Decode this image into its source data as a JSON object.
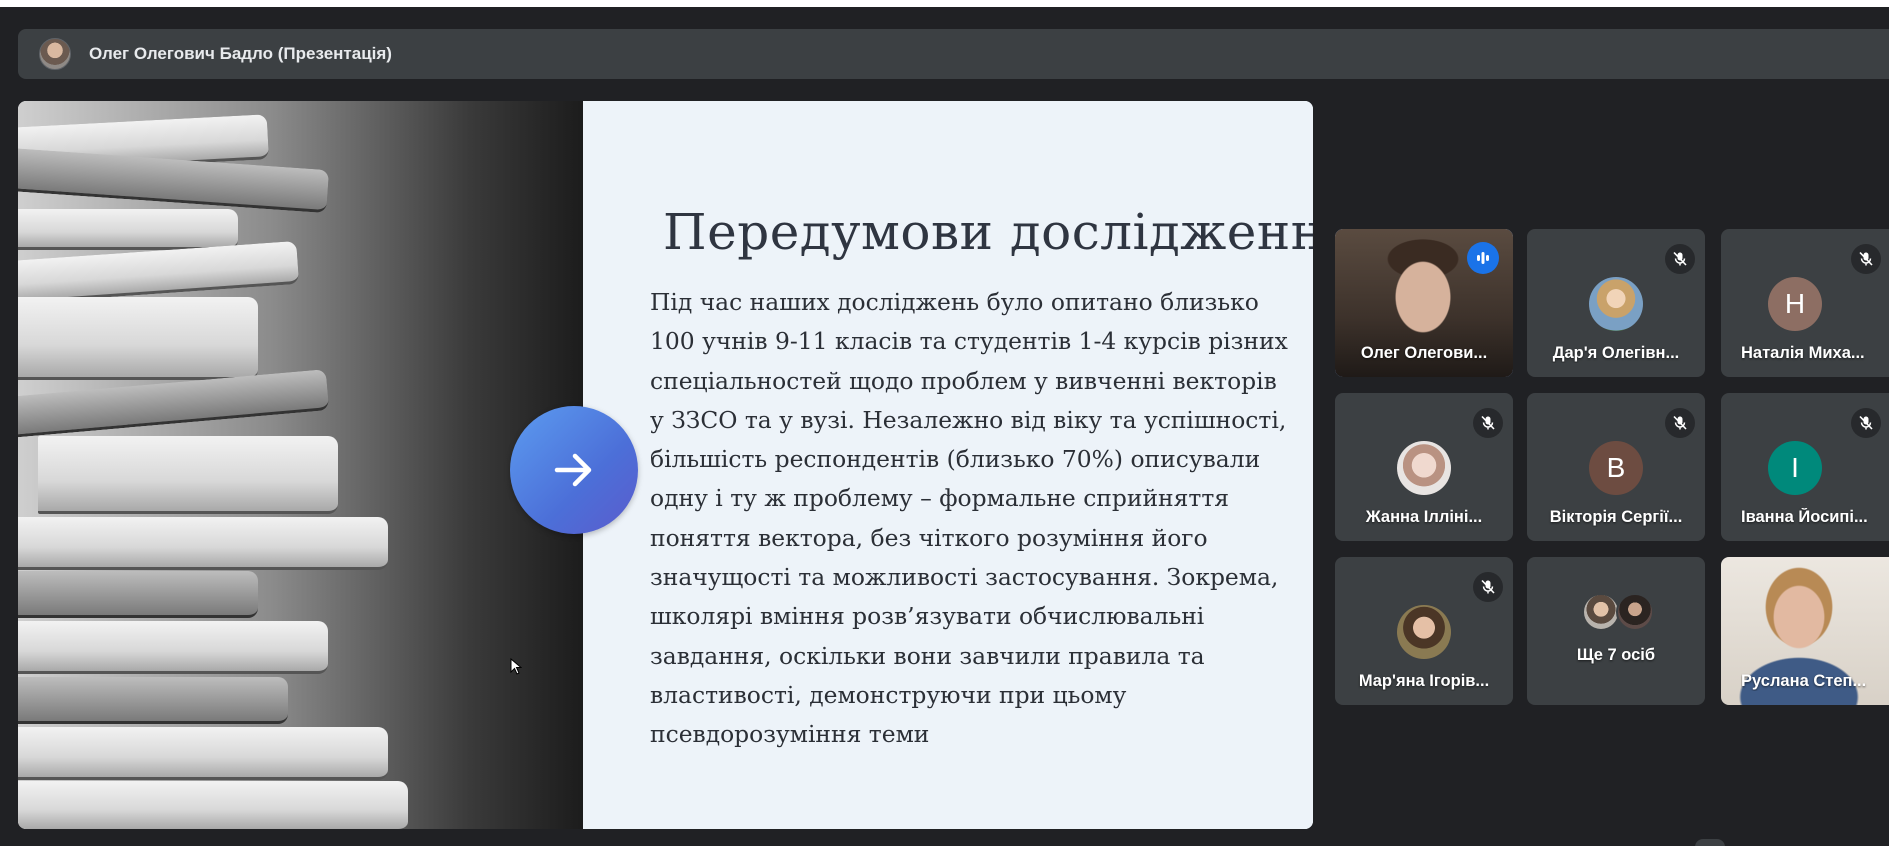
{
  "presenter": {
    "name": "Олег Олегович Бадло (Презентація)"
  },
  "slide": {
    "title": "Передумови дослідження",
    "body": "Під час наших досліджень було опитано близько\n100 учнів 9-11 класів та студентів 1-4 курсів різних\nспеціальностей щодо проблем у вивченні векторів\nу ЗЗСО та у вузі. Незалежно від віку та успішності,\nбільшість респондентів (близько 70%) описували\nодну і ту ж проблему – формальне сприйняття\nпоняття вектора, без чіткого розуміння його\nзначущості та можливості застосування. Зокрема,\nшколярі вміння розв’язувати обчислювальні\nзавдання, оскільки вони завчили правила та\nвластивості, демонструючи при цьому\nпсевдорозуміння теми",
    "next_icon": "arrow-right-icon"
  },
  "participants": [
    {
      "name": "Олег Олегови...",
      "state": "speaking",
      "video": true
    },
    {
      "name": "Дар'я Олегівн...",
      "state": "muted",
      "avatar": "photo",
      "avatar_color": "#7aa0c4"
    },
    {
      "name": "Наталія Миха...",
      "state": "muted",
      "initial": "Н",
      "avatar_color": "#8d6e63"
    },
    {
      "name": "Жанна Ілліні...",
      "state": "muted",
      "avatar": "photo",
      "avatar_color": "#d7c6c0"
    },
    {
      "name": "Вікторія Сергії...",
      "state": "muted",
      "initial": "В",
      "avatar_color": "#6d4c41"
    },
    {
      "name": "Іванна Йосипі...",
      "state": "muted",
      "initial": "І",
      "avatar_color": "#00897b"
    },
    {
      "name": "Мар'яна Ігорів...",
      "state": "muted",
      "avatar": "photo",
      "avatar_color": "#8a7a52"
    },
    {
      "name": "Ще 7 осіб",
      "state": "more"
    },
    {
      "name": "Руслана Степ...",
      "state": "video",
      "video": true
    }
  ],
  "icons": {
    "muted": "mic-off-icon",
    "speaking": "audio-level-icon"
  },
  "colors": {
    "background": "#202124",
    "tile": "#3c4043",
    "active_outline": "#8ab4f8",
    "speaking": "#1a73e8"
  }
}
